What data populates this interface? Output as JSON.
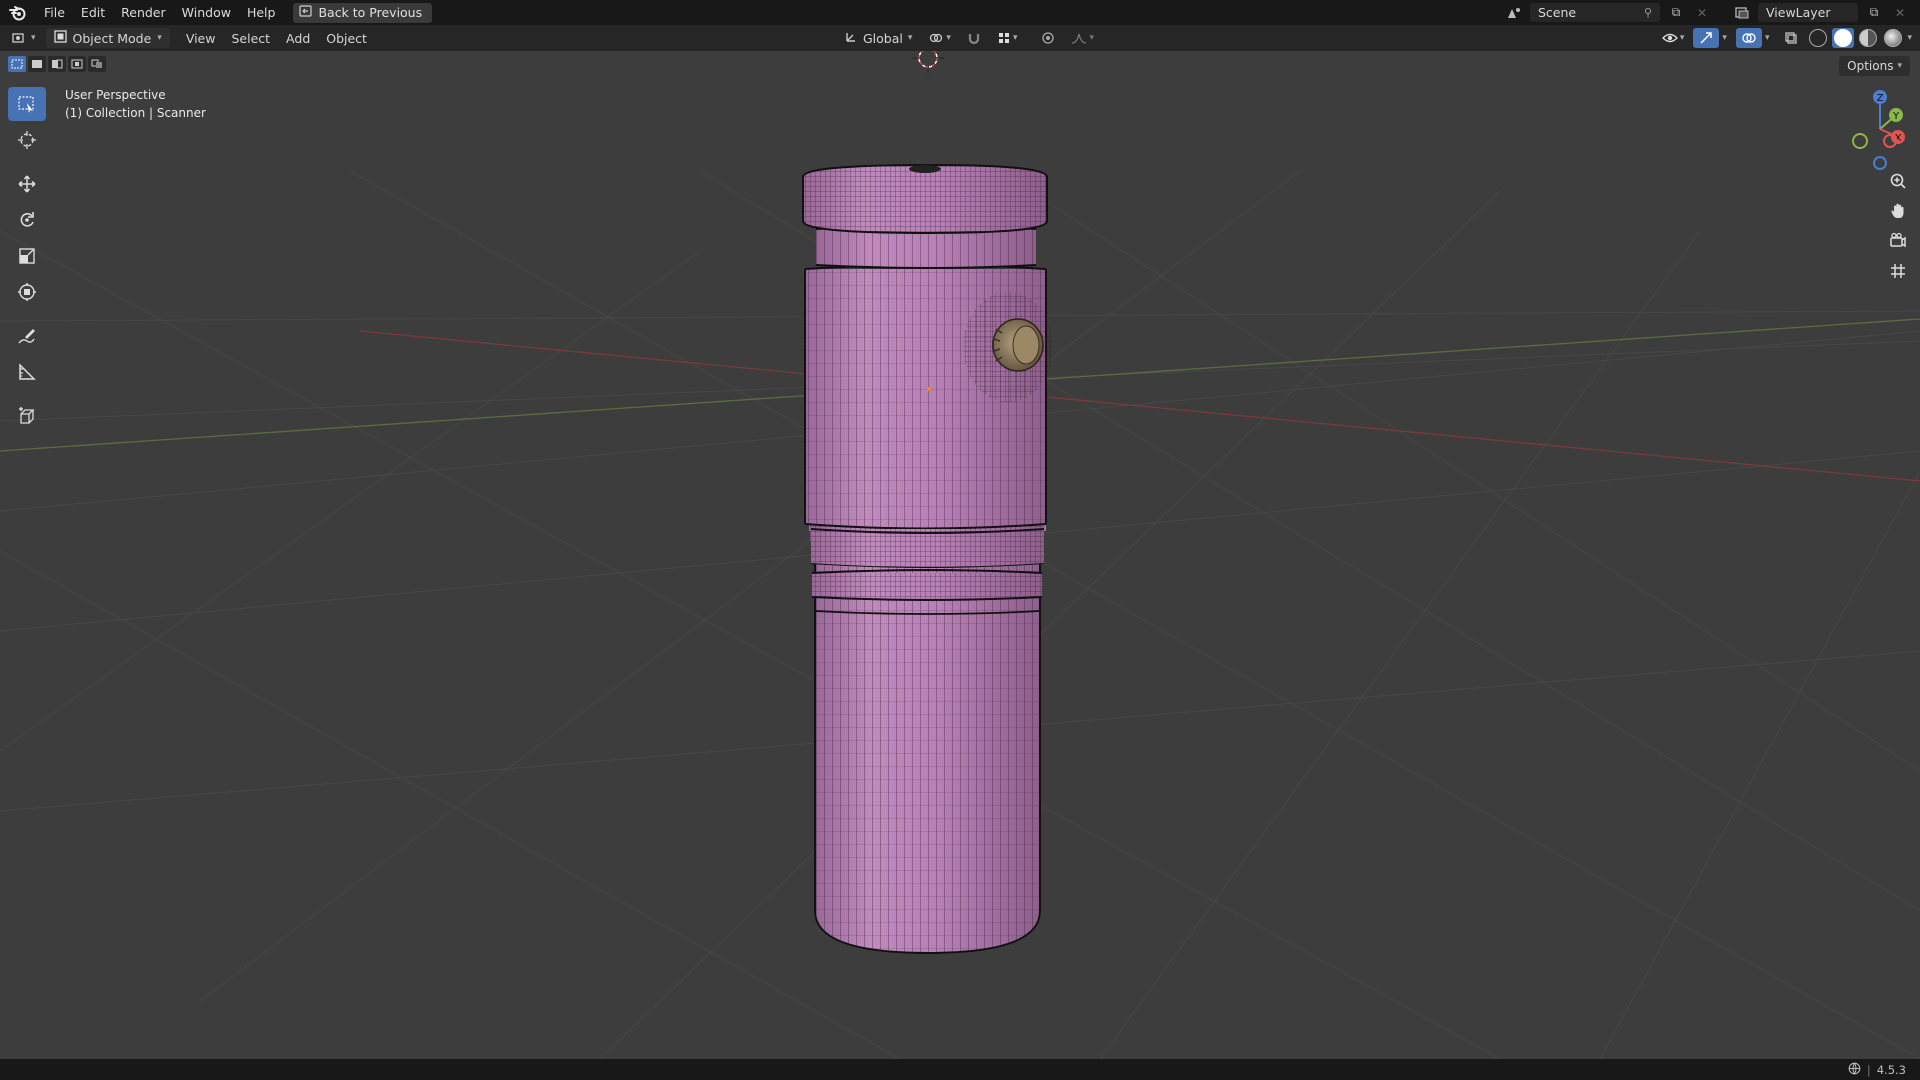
{
  "menu": {
    "file": "File",
    "edit": "Edit",
    "render": "Render",
    "window": "Window",
    "help": "Help",
    "back_to_previous": "Back to Previous"
  },
  "topbar_right": {
    "scene": "Scene",
    "view_layer": "ViewLayer"
  },
  "header": {
    "mode": "Object Mode",
    "view": "View",
    "select": "Select",
    "add": "Add",
    "object": "Object",
    "transform_orientation": "Global"
  },
  "viewport": {
    "perspective": "User Perspective",
    "collection_info": "(1) Collection | Scanner",
    "options": "Options",
    "object_color": "#b880b6",
    "knob_color": "#8c7a5c"
  },
  "gizmo": {
    "z": "Z",
    "y": "Y",
    "x": "X"
  },
  "status": {
    "version": "4.5.3"
  }
}
